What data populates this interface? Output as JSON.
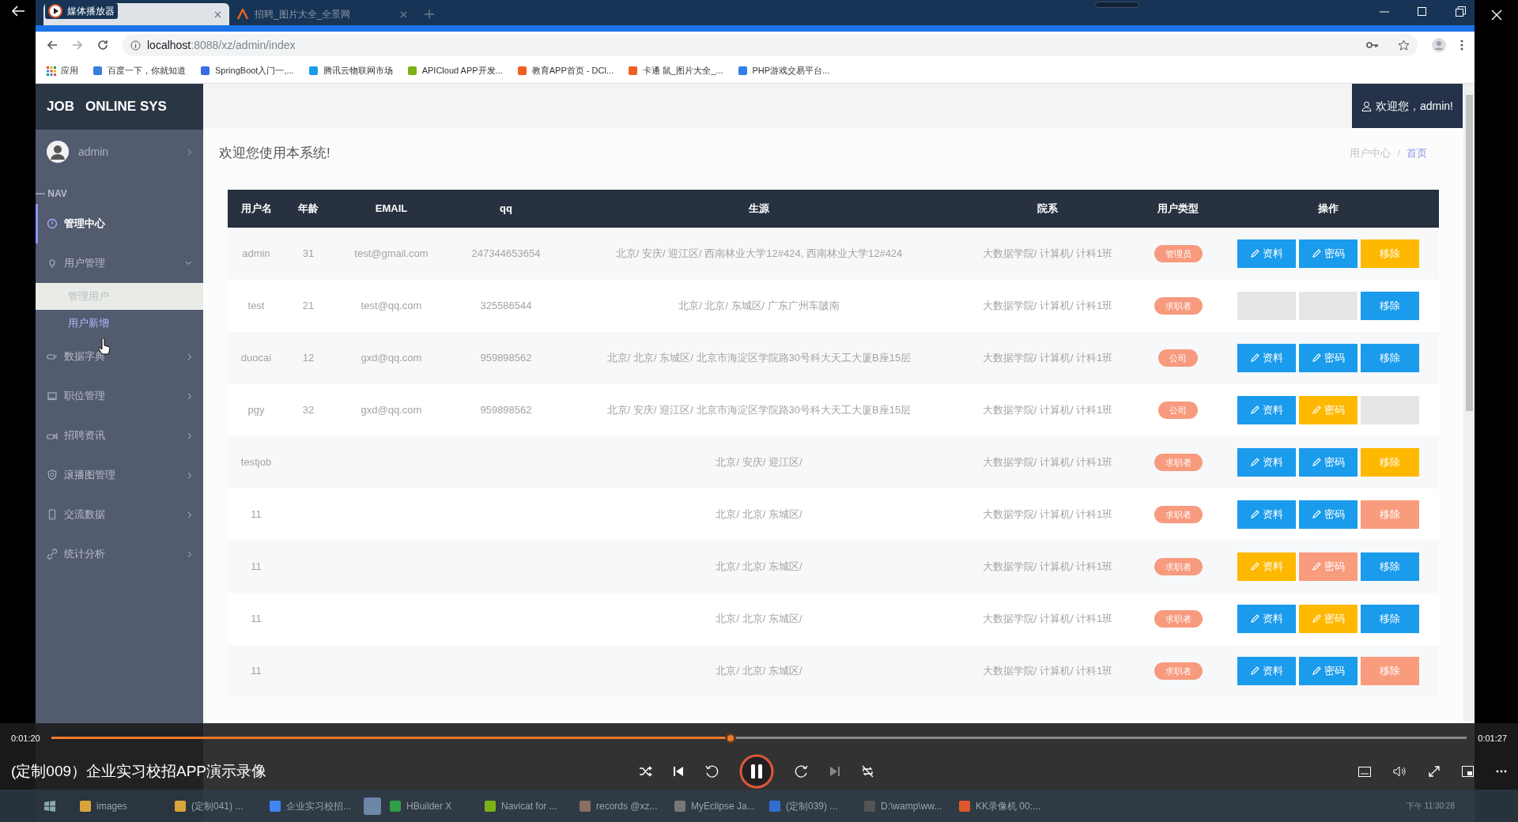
{
  "player": {
    "title": "媒体播放器",
    "video_title": "(定制009）企业实习校招APP演示录像",
    "elapsed": "0:01:20",
    "total": "0:01:27",
    "level": 0.48,
    "playing": true
  },
  "browser": {
    "tabs": [
      {
        "selected": true
      },
      {
        "label": "招聘_图片大全_全景网",
        "selected": false
      }
    ],
    "url_host": "localhost",
    "url_path": ":8088/xz/admin/index",
    "bookmarks": [
      "应用",
      "百度一下，你就知道",
      "SpringBoot入门一,...",
      "腾讯云物联网市场",
      "APICloud APP开发...",
      "教育APP首页 - DCl...",
      "卡通 鼠_图片大全_...",
      "PHP游戏交易平台..."
    ]
  },
  "sidebar": {
    "brand": "JOB",
    "brand_2": "ONLINE SYS",
    "user": "admin",
    "nav_heading": "--- NAV",
    "items": [
      {
        "label": "管理中心",
        "kind": "link",
        "selected": true
      },
      {
        "label": "用户管理",
        "kind": "group",
        "selected": false,
        "expanded": true,
        "children": [
          {
            "label": "管理用户",
            "selected": true
          },
          {
            "label": "用户新增",
            "selected": false
          }
        ]
      },
      {
        "label": "数据字典",
        "kind": "group",
        "selected": false,
        "expanded": false
      },
      {
        "label": "职位管理",
        "kind": "group",
        "selected": false,
        "expanded": false
      },
      {
        "label": "招聘资讯",
        "kind": "group",
        "selected": false,
        "expanded": false
      },
      {
        "label": "滚播图管理",
        "kind": "group",
        "selected": false,
        "expanded": false
      },
      {
        "label": "交流数据",
        "kind": "group",
        "selected": false,
        "expanded": false
      },
      {
        "label": "统计分析",
        "kind": "group",
        "selected": false,
        "expanded": false
      }
    ]
  },
  "header": {
    "welcome": "欢迎您，admin!"
  },
  "page_title": "欢迎您使用本系统!",
  "breadcrumb_separator": "/",
  "breadcrumb": [
    {
      "label": "用户中心",
      "link": false
    },
    {
      "label": "首页",
      "link": true
    }
  ],
  "table": {
    "columns": [
      "用户名",
      "年龄",
      "EMAIL",
      "qq",
      "生源",
      "院系",
      "用户类型",
      "操作"
    ],
    "rows": [
      {
        "cells": [
          "admin",
          "31",
          "test@gmail.com",
          "247344653654",
          "北京/ 安庆/ 迎江区/ 西南林业大学12#424, 西南林业大学12#424",
          "大数据学院/ 计算机/ 计科1班"
        ],
        "type": "管理员",
        "actions": [
          {
            "kind": "edit",
            "label": "资料",
            "color": "#1a9bec"
          },
          {
            "kind": "edit",
            "label": "密码",
            "color": "#1a9bec"
          },
          {
            "kind": "remove",
            "label": "移除",
            "color": "#ffb800"
          }
        ]
      },
      {
        "cells": [
          "test",
          "21",
          "test@qq.com",
          "325586544",
          "北京/ 北京/ 东城区/ 广东广州车陂南",
          "大数据学院/ 计算机/ 计科1班"
        ],
        "type": "求职者",
        "actions": [
          {
            "kind": "edit",
            "color": "#e6e6e6"
          },
          {
            "kind": "edit",
            "color": "#e6e6e6"
          },
          {
            "kind": "remove",
            "label": "移除",
            "color": "#1a9bec"
          }
        ]
      },
      {
        "cells": [
          "duocai",
          "12",
          "gxd@qq.com",
          "959898562",
          "北京/ 北京/ 东城区/ 北京市海淀区学院路30号科大天工大厦B座15层",
          "大数据学院/ 计算机/ 计科1班"
        ],
        "type": "公司",
        "actions": [
          {
            "kind": "edit",
            "label": "资料",
            "color": "#1a9bec"
          },
          {
            "kind": "edit",
            "label": "密码",
            "color": "#1a9bec"
          },
          {
            "kind": "remove",
            "label": "移除",
            "color": "#1a9bec"
          }
        ]
      },
      {
        "cells": [
          "pgy",
          "32",
          "gxd@qq.com",
          "959898562",
          "北京/ 安庆/ 迎江区/ 北京市海淀区学院路30号科大天工大厦B座15层",
          "大数据学院/ 计算机/ 计科1班"
        ],
        "type": "公司",
        "actions": [
          {
            "kind": "edit",
            "label": "资料",
            "color": "#1a9bec"
          },
          {
            "kind": "edit",
            "label": "密码",
            "color": "#ffb800"
          },
          {
            "kind": "remove",
            "color": "#e6e6e6"
          }
        ]
      },
      {
        "cells": [
          "testjob",
          null,
          null,
          null,
          "北京/ 安庆/ 迎江区/",
          "大数据学院/ 计算机/ 计科1班"
        ],
        "type": "求职者",
        "actions": [
          {
            "kind": "edit",
            "label": "资料",
            "color": "#1a9bec"
          },
          {
            "kind": "edit",
            "label": "密码",
            "color": "#1a9bec"
          },
          {
            "kind": "remove",
            "label": "移除",
            "color": "#ffb800"
          }
        ]
      },
      {
        "cells": [
          "11",
          null,
          null,
          null,
          "北京/ 北京/ 东城区/",
          "大数据学院/ 计算机/ 计科1班"
        ],
        "type": "求职者",
        "actions": [
          {
            "kind": "edit",
            "label": "资料",
            "color": "#1a9bec"
          },
          {
            "kind": "edit",
            "label": "密码",
            "color": "#1a9bec"
          },
          {
            "kind": "remove",
            "label": "移除",
            "color": "#f99b7d"
          }
        ]
      },
      {
        "cells": [
          "11",
          null,
          null,
          null,
          "北京/ 北京/ 东城区/",
          "大数据学院/ 计算机/ 计科1班"
        ],
        "type": "求职者",
        "actions": [
          {
            "kind": "edit",
            "label": "资料",
            "color": "#ffb800"
          },
          {
            "kind": "edit",
            "label": "密码",
            "color": "#f99b7d"
          },
          {
            "kind": "remove",
            "label": "移除",
            "color": "#1a9bec"
          }
        ]
      },
      {
        "cells": [
          "11",
          null,
          null,
          null,
          "北京/ 北京/ 东城区/",
          "大数据学院/ 计算机/ 计科1班"
        ],
        "type": "求职者",
        "actions": [
          {
            "kind": "edit",
            "label": "资料",
            "color": "#1a9bec"
          },
          {
            "kind": "edit",
            "label": "密码",
            "color": "#ffb800"
          },
          {
            "kind": "remove",
            "label": "移除",
            "color": "#1a9bec"
          }
        ]
      },
      {
        "cells": [
          "11",
          null,
          null,
          null,
          "北京/ 北京/ 东城区/",
          "大数据学院/ 计算机/ 计科1班"
        ],
        "type": "求职者",
        "actions": [
          {
            "kind": "edit",
            "label": "资料",
            "color": "#1a9bec"
          },
          {
            "kind": "edit",
            "label": "密码",
            "color": "#1a9bec"
          },
          {
            "kind": "remove",
            "label": "移除",
            "color": "#f99b7d"
          }
        ]
      }
    ]
  },
  "taskbar": {
    "items": [
      {
        "kind": "app",
        "label": "images"
      },
      {
        "kind": "app",
        "label": "(定制041) ..."
      },
      {
        "kind": "app",
        "label": "企业实习校招..."
      },
      {
        "kind": "icon"
      },
      {
        "kind": "app",
        "label": "HBuilder X"
      },
      {
        "kind": "app",
        "label": "Navicat for ..."
      },
      {
        "kind": "app",
        "label": "records @xz..."
      },
      {
        "kind": "app",
        "label": "MyEclipse Ja..."
      },
      {
        "kind": "app",
        "label": "(定制039) ..."
      },
      {
        "kind": "app",
        "label": "D:\\wamp\\ww..."
      },
      {
        "kind": "app",
        "label": "KK录像机 00:..."
      }
    ],
    "clock": "下午 11:30:28"
  }
}
